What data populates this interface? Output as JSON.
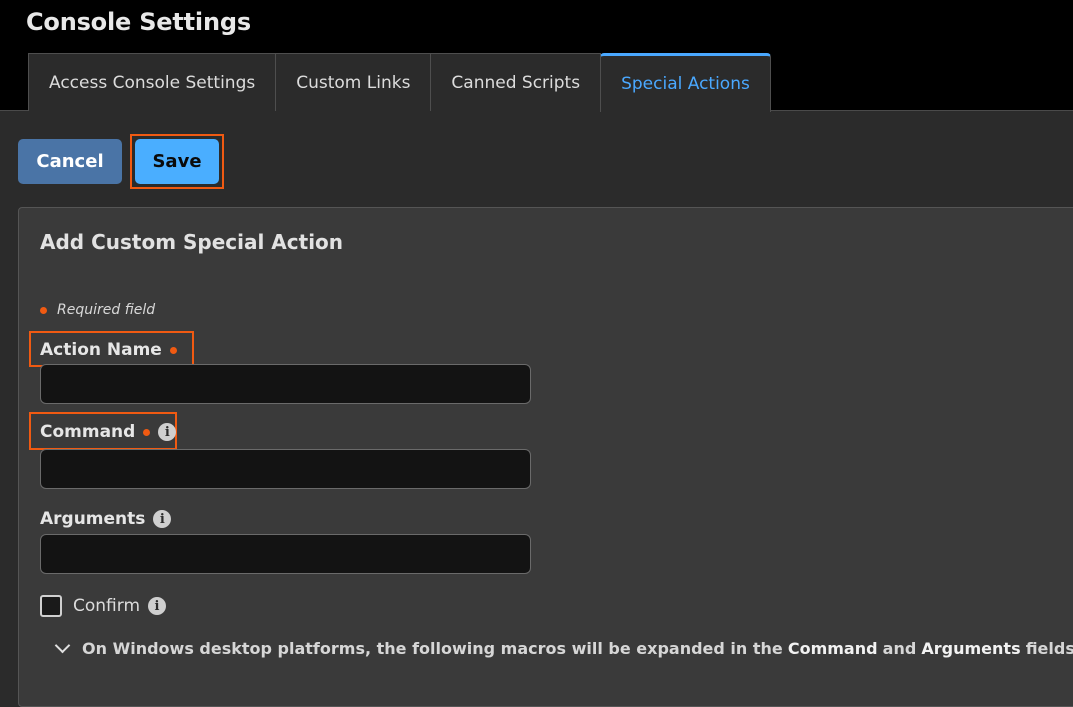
{
  "header": {
    "title": "Console Settings"
  },
  "tabs": [
    {
      "label": "Access Console Settings",
      "active": false
    },
    {
      "label": "Custom Links",
      "active": false
    },
    {
      "label": "Canned Scripts",
      "active": false
    },
    {
      "label": "Special Actions",
      "active": true
    }
  ],
  "toolbar": {
    "cancel_label": "Cancel",
    "save_label": "Save"
  },
  "form": {
    "title": "Add Custom Special Action",
    "required_note": "Required field",
    "action_name": {
      "label": "Action Name",
      "value": "",
      "required": true
    },
    "command": {
      "label": "Command",
      "value": "",
      "required": true,
      "info_icon": "info-icon"
    },
    "arguments": {
      "label": "Arguments",
      "value": "",
      "required": false,
      "info_icon": "info-icon"
    },
    "confirm": {
      "label": "Confirm",
      "checked": false,
      "info_icon": "info-icon"
    },
    "macros": {
      "prefix": "On Windows desktop platforms, the following macros will be expanded in the",
      "command_word": "Command",
      "and": "and",
      "arguments_word": "Arguments",
      "suffix": "fields:",
      "expanded": false
    }
  },
  "colors": {
    "accent": "#4aa8ff",
    "cancel_button": "#4a74a6",
    "save_button": "#4aaeff",
    "required_dot": "#f05a12",
    "highlight": "#f05a12"
  }
}
